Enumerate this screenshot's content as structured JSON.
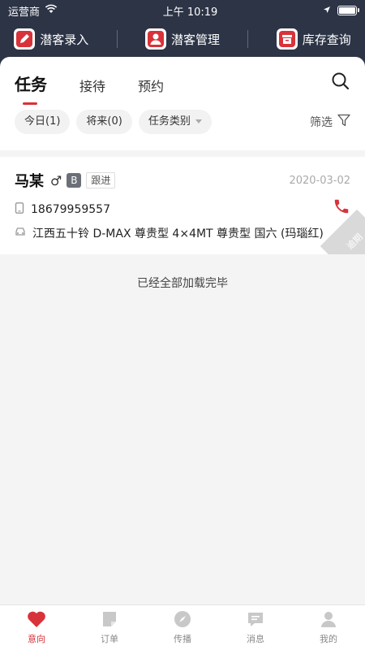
{
  "status": {
    "carrier": "运营商",
    "time": "上午 10:19"
  },
  "quick_actions": [
    {
      "label": "潜客录入",
      "icon": "edit-icon"
    },
    {
      "label": "潜客管理",
      "icon": "person-icon"
    },
    {
      "label": "库存查询",
      "icon": "box-icon"
    }
  ],
  "tabs": [
    "任务",
    "接待",
    "预约"
  ],
  "chips": [
    "今日(1)",
    "将来(0)",
    "任务类别"
  ],
  "filter_label": "筛选",
  "customer": {
    "name": "马某",
    "gender": "♂",
    "level": "B",
    "tag": "跟进",
    "date": "2020-03-02",
    "phone": "18679959557",
    "car": "江西五十铃 D-MAX 尊贵型 4×4MT 尊贵型 国六 (玛瑙红)",
    "overdue_label": "逾期"
  },
  "list_end_text": "已经全部加载完毕",
  "tabbar": [
    "意向",
    "订单",
    "传播",
    "消息",
    "我的"
  ],
  "colors": {
    "accent": "#d8323a",
    "header": "#2c3446"
  }
}
